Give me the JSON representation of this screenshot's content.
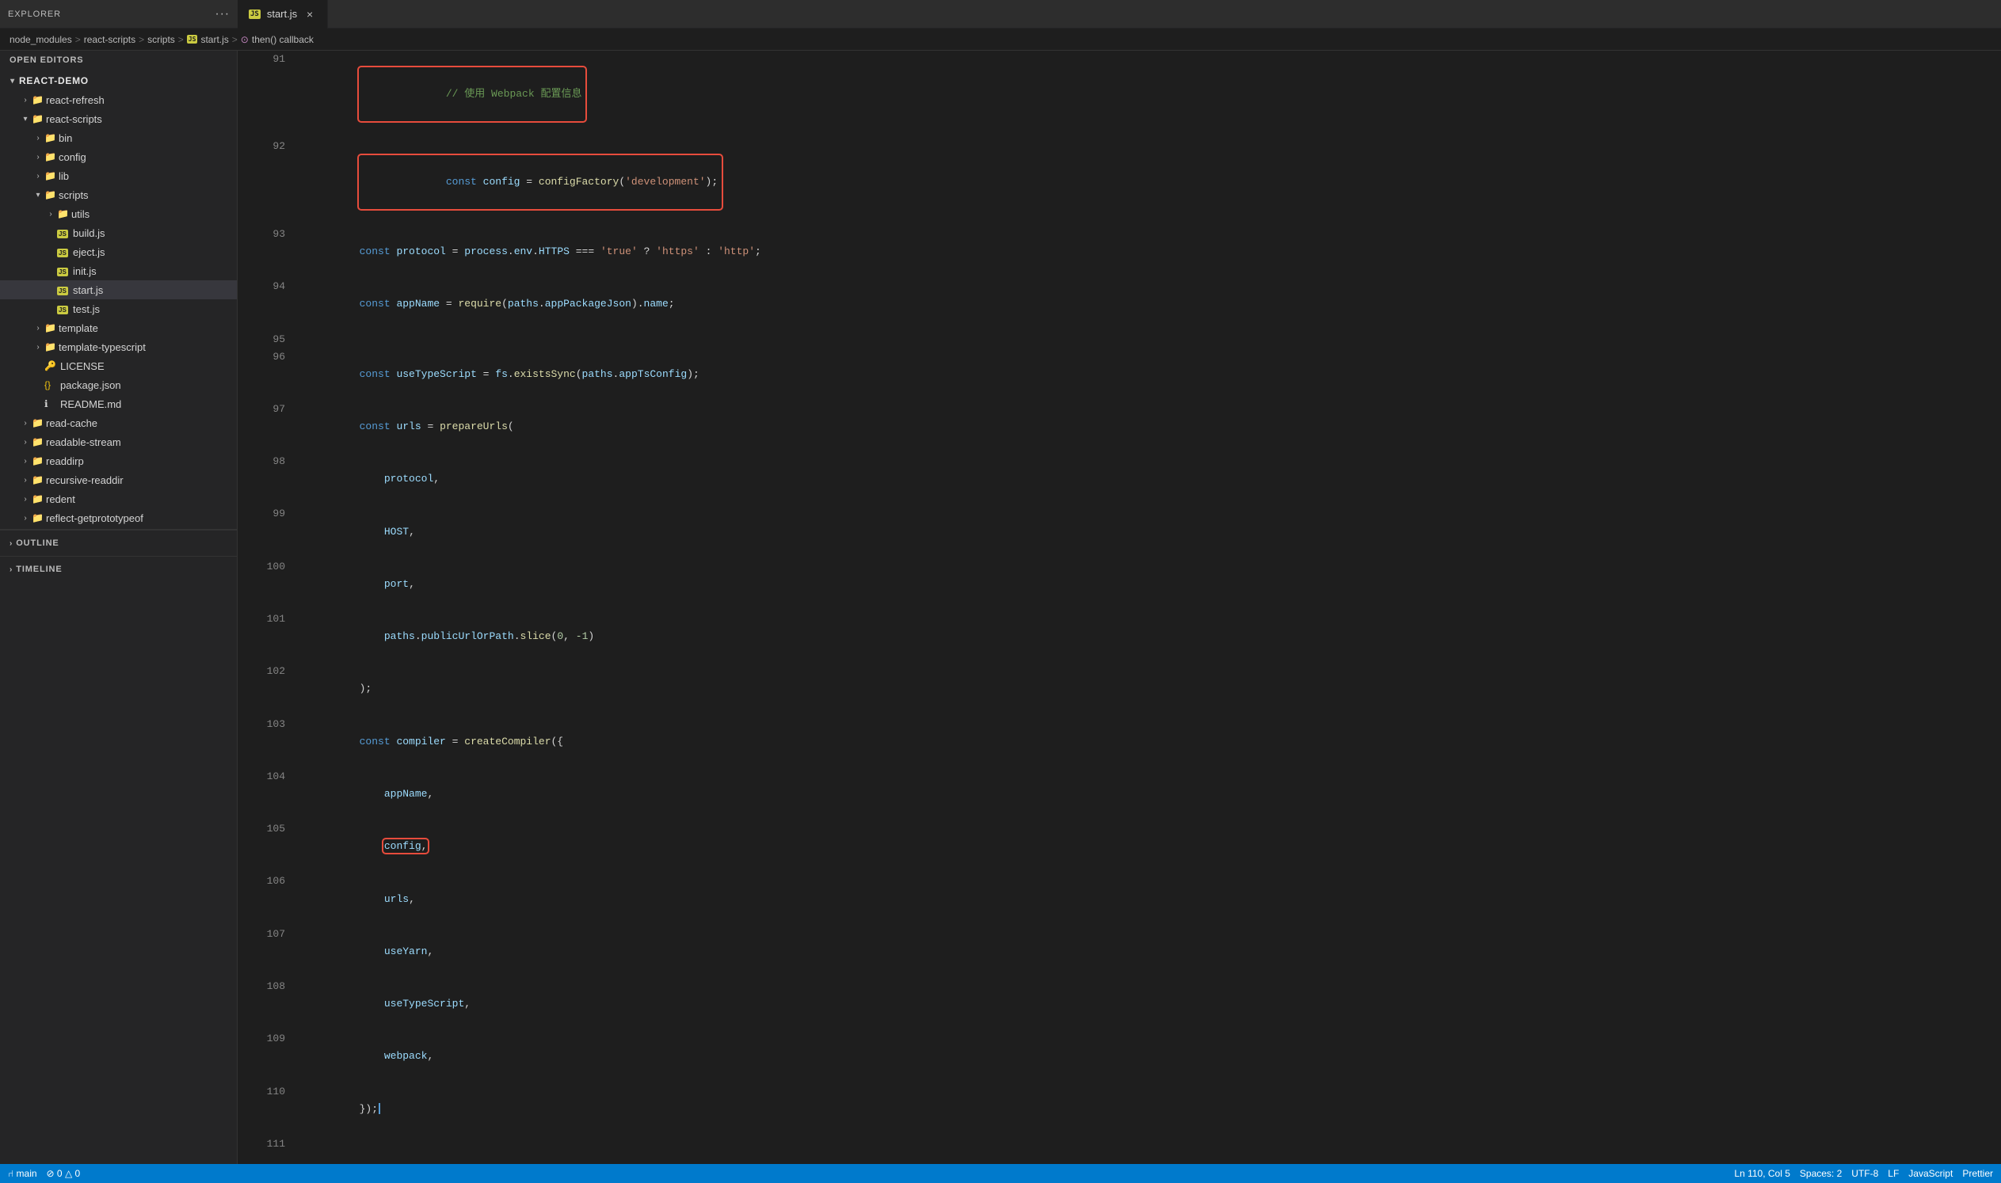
{
  "tabs": {
    "left_panel_title": "EXPLORER",
    "more_label": "···",
    "active_tab": {
      "icon": "JS",
      "label": "start.js",
      "close": "×"
    }
  },
  "breadcrumb": {
    "items": [
      "node_modules",
      "react-scripts",
      "scripts",
      "start.js",
      "then() callback"
    ],
    "separators": [
      ">",
      ">",
      ">",
      ">"
    ]
  },
  "sidebar": {
    "open_editors_label": "OPEN EDITORS",
    "project_name": "REACT-DEMO",
    "tree": [
      {
        "indent": 16,
        "arrow": "",
        "icon": "📁",
        "label": "react-refresh",
        "type": "folder-collapsed",
        "depth": 2
      },
      {
        "indent": 16,
        "arrow": "▾",
        "icon": "📁",
        "label": "react-scripts",
        "type": "folder-open",
        "depth": 2
      },
      {
        "indent": 32,
        "arrow": "›",
        "icon": "📁",
        "label": "bin",
        "type": "folder-collapsed",
        "depth": 3
      },
      {
        "indent": 32,
        "arrow": "›",
        "icon": "📁",
        "label": "config",
        "type": "folder-collapsed",
        "depth": 3
      },
      {
        "indent": 32,
        "arrow": "›",
        "icon": "📁",
        "label": "lib",
        "type": "folder-collapsed",
        "depth": 3
      },
      {
        "indent": 32,
        "arrow": "▾",
        "icon": "📁",
        "label": "scripts",
        "type": "folder-open",
        "depth": 3
      },
      {
        "indent": 48,
        "arrow": "›",
        "icon": "📁",
        "label": "utils",
        "type": "folder-collapsed",
        "depth": 4
      },
      {
        "indent": 48,
        "arrow": "",
        "icon": "JS",
        "label": "build.js",
        "type": "file-js",
        "depth": 4
      },
      {
        "indent": 48,
        "arrow": "",
        "icon": "JS",
        "label": "eject.js",
        "type": "file-js",
        "depth": 4
      },
      {
        "indent": 48,
        "arrow": "",
        "icon": "JS",
        "label": "init.js",
        "type": "file-js",
        "depth": 4
      },
      {
        "indent": 48,
        "arrow": "",
        "icon": "JS",
        "label": "start.js",
        "type": "file-js",
        "depth": 4,
        "active": true
      },
      {
        "indent": 48,
        "arrow": "",
        "icon": "JS",
        "label": "test.js",
        "type": "file-js",
        "depth": 4
      },
      {
        "indent": 32,
        "arrow": "›",
        "icon": "📁",
        "label": "template",
        "type": "folder-collapsed",
        "depth": 3
      },
      {
        "indent": 32,
        "arrow": "›",
        "icon": "📁",
        "label": "template-typescript",
        "type": "folder-collapsed",
        "depth": 3
      },
      {
        "indent": 32,
        "arrow": "",
        "icon": "🔑",
        "label": "LICENSE",
        "type": "file-license",
        "depth": 3
      },
      {
        "indent": 32,
        "arrow": "",
        "icon": "{}",
        "label": "package.json",
        "type": "file-json",
        "depth": 3
      },
      {
        "indent": 32,
        "arrow": "",
        "icon": "ℹ",
        "label": "README.md",
        "type": "file-md",
        "depth": 3
      },
      {
        "indent": 16,
        "arrow": "›",
        "icon": "📁",
        "label": "read-cache",
        "type": "folder-collapsed",
        "depth": 2
      },
      {
        "indent": 16,
        "arrow": "›",
        "icon": "📁",
        "label": "readable-stream",
        "type": "folder-collapsed",
        "depth": 2
      },
      {
        "indent": 16,
        "arrow": "›",
        "icon": "📁",
        "label": "readdirp",
        "type": "folder-collapsed",
        "depth": 2
      },
      {
        "indent": 16,
        "arrow": "›",
        "icon": "📁",
        "label": "recursive-readdir",
        "type": "folder-collapsed",
        "depth": 2
      },
      {
        "indent": 16,
        "arrow": "›",
        "icon": "📁",
        "label": "redent",
        "type": "folder-collapsed",
        "depth": 2
      },
      {
        "indent": 16,
        "arrow": "›",
        "icon": "📁",
        "label": "reflect-getprototypeof",
        "type": "folder-collapsed",
        "depth": 2
      }
    ],
    "outline_label": "OUTLINE",
    "timeline_label": "TIMELINE"
  },
  "code": {
    "lines": [
      {
        "num": "91",
        "content": "comment_webpack",
        "highlight_box": true
      },
      {
        "num": "92",
        "content": "const_config_factory",
        "highlight_box": true
      },
      {
        "num": "93",
        "content": "const_protocol"
      },
      {
        "num": "94",
        "content": "const_appname"
      },
      {
        "num": "95",
        "content": "empty"
      },
      {
        "num": "96",
        "content": "const_typescript"
      },
      {
        "num": "97",
        "content": "const_urls"
      },
      {
        "num": "98",
        "content": "protocol_comma"
      },
      {
        "num": "99",
        "content": "host_comma"
      },
      {
        "num": "100",
        "content": "port_comma"
      },
      {
        "num": "101",
        "content": "paths_slice"
      },
      {
        "num": "102",
        "content": "paren_semi"
      },
      {
        "num": "103",
        "content": "const_compiler"
      },
      {
        "num": "104",
        "content": "appname_comma"
      },
      {
        "num": "105",
        "content": "config_comma",
        "highlight_box_small": true
      },
      {
        "num": "106",
        "content": "urls_comma"
      },
      {
        "num": "107",
        "content": "useyarn_comma"
      },
      {
        "num": "108",
        "content": "usetypescript_comma"
      },
      {
        "num": "109",
        "content": "webpack_comma"
      },
      {
        "num": "110",
        "content": "close_brace"
      },
      {
        "num": "111",
        "content": "empty"
      }
    ]
  },
  "status_bar": {
    "git_branch": "main",
    "errors": "0",
    "warnings": "0",
    "line_col": "Ln 110, Col 5",
    "spaces": "Spaces: 2",
    "encoding": "UTF-8",
    "eol": "LF",
    "language": "JavaScript",
    "prettier": "Prettier"
  }
}
